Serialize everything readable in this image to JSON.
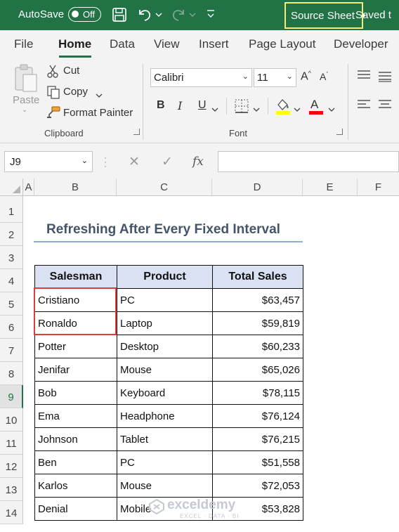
{
  "titlebar": {
    "autosave_label": "AutoSave",
    "autosave_state": "Off",
    "document_title": "Source Sheet",
    "separator": "•",
    "save_status": "Saved t"
  },
  "ribbon": {
    "tabs": [
      "File",
      "Home",
      "Data",
      "View",
      "Insert",
      "Page Layout",
      "Developer"
    ],
    "active_tab": "Home",
    "clipboard": {
      "paste": "Paste",
      "cut": "Cut",
      "copy": "Copy",
      "format_painter": "Format Painter",
      "group_label": "Clipboard"
    },
    "font": {
      "font_name": "Calibri",
      "font_size": "11",
      "bold": "B",
      "italic": "I",
      "underline": "U",
      "font_color_letter": "A",
      "group_label": "Font"
    }
  },
  "formula_bar": {
    "name_box": "J9",
    "cancel": "✕",
    "enter": "✓",
    "fx": "fx",
    "formula": ""
  },
  "sheet": {
    "columns": [
      "A",
      "B",
      "C",
      "D",
      "E",
      "F"
    ],
    "rows": [
      "1",
      "2",
      "3",
      "4",
      "5",
      "6",
      "7",
      "8",
      "9",
      "10",
      "11",
      "12",
      "13",
      "14"
    ],
    "selected_row": "9",
    "title": "Refreshing After Every Fixed Interval",
    "table": {
      "headers": [
        "Salesman",
        "Product",
        "Total Sales"
      ],
      "rows": [
        [
          "Cristiano",
          "PC",
          "$63,457"
        ],
        [
          "Ronaldo",
          "Laptop",
          "$59,819"
        ],
        [
          "Potter",
          "Desktop",
          "$60,233"
        ],
        [
          "Jenifar",
          "Mouse",
          "$65,026"
        ],
        [
          "Bob",
          "Keyboard",
          "$78,115"
        ],
        [
          "Ema",
          "Headphone",
          "$76,124"
        ],
        [
          "Johnson",
          "Tablet",
          "$76,215"
        ],
        [
          "Ben",
          "PC",
          "$51,558"
        ],
        [
          "Karlos",
          "Mouse",
          "$72,053"
        ],
        [
          "Denial",
          "Mobile",
          "$53,828"
        ]
      ]
    }
  },
  "watermark": {
    "brand": "exceldemy",
    "tagline": "EXCEL · DATA · BI"
  },
  "colors": {
    "excel_green": "#217346",
    "title_highlight": "#f2ec7a",
    "header_fill": "#d9e1f2",
    "title_text": "#44546a",
    "title_rule": "#8ea9db",
    "highlight_box": "#e03c3c",
    "fill_color_swatch": "#ffff00",
    "font_color_swatch": "#ff0000"
  }
}
